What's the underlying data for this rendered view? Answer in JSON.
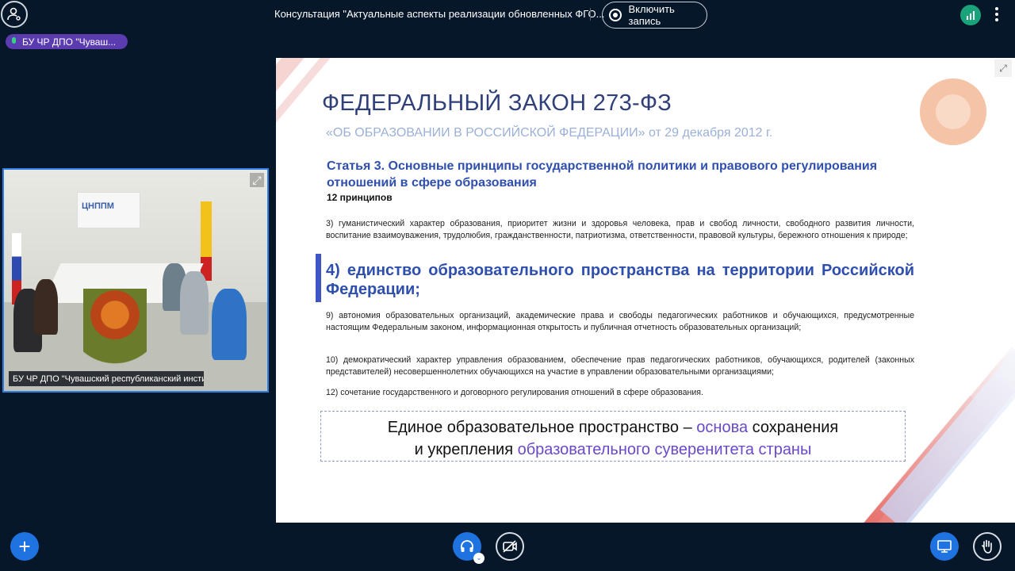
{
  "topbar": {
    "conference_title": "Консультация \"Актуальные аспекты реализации обновленных ФГО...",
    "record_label": "Включить запись"
  },
  "speaker": {
    "name": "БУ ЧР ДПО \"Чуваш..."
  },
  "video": {
    "participant_label": "БУ ЧР ДПО \"Чувашский республиканский инсти...",
    "banner_text": "ЦНППМ"
  },
  "slide": {
    "title": "ФЕДЕРАЛЬНЫЙ ЗАКОН 273-ФЗ",
    "subtitle": "«ОБ ОБРАЗОВАНИИ В РОССИЙСКОЙ ФЕДЕРАЦИИ» от 29 декабря 2012 г.",
    "article": "Статья 3. Основные принципы государственной политики и правового регулирования отношений в сфере образования",
    "count": "12 принципов",
    "p3": "3) гуманистический характер образования, приоритет жизни и здоровья человека, прав и свобод личности, свободного развития личности, воспитание взаимоуважения, трудолюбия, гражданственности, патриотизма, ответственности, правовой культуры, бережного отношения к природе;",
    "p4": "4) единство образовательного пространства на территории Российской Федерации;",
    "p9": "9) автономия образовательных организаций, академические права и свободы педагогических работников и обучающихся, предусмотренные настоящим Федеральным законом, информационная открытость и публичная отчетность образовательных организаций;",
    "p10": "10) демократический характер управления образованием, обеспечение прав педагогических работников, обучающихся, родителей (законных представителей) несовершеннолетних обучающихся на участие в управлении образовательными организациями;",
    "p12": "12) сочетание государственного и договорного регулирования отношений в сфере образования.",
    "conclusion": {
      "part1": "Единое образовательное пространство – ",
      "accent1": "основа",
      "part2": " сохранения",
      "part3": "и укрепления ",
      "accent2": "образовательного суверенитета страны"
    }
  },
  "colors": {
    "background": "#06172a",
    "accent_blue": "#1f73e0",
    "speaker_pill": "#5a3bb0",
    "slide_title": "#2f3f79",
    "slide_heading": "#2f4fae",
    "conclusion_accent": "#6a49c8",
    "signal": "#1aa37a"
  },
  "icons": {
    "user": "user-settings-icon",
    "record": "record-icon",
    "signal": "signal-strength-icon",
    "menu": "more-vertical-icon",
    "mic": "microphone-icon",
    "expand": "expand-icon",
    "add": "plus-icon",
    "headphones": "headphones-icon",
    "camera": "camera-off-icon",
    "share": "screen-share-icon",
    "hand": "raise-hand-icon"
  }
}
